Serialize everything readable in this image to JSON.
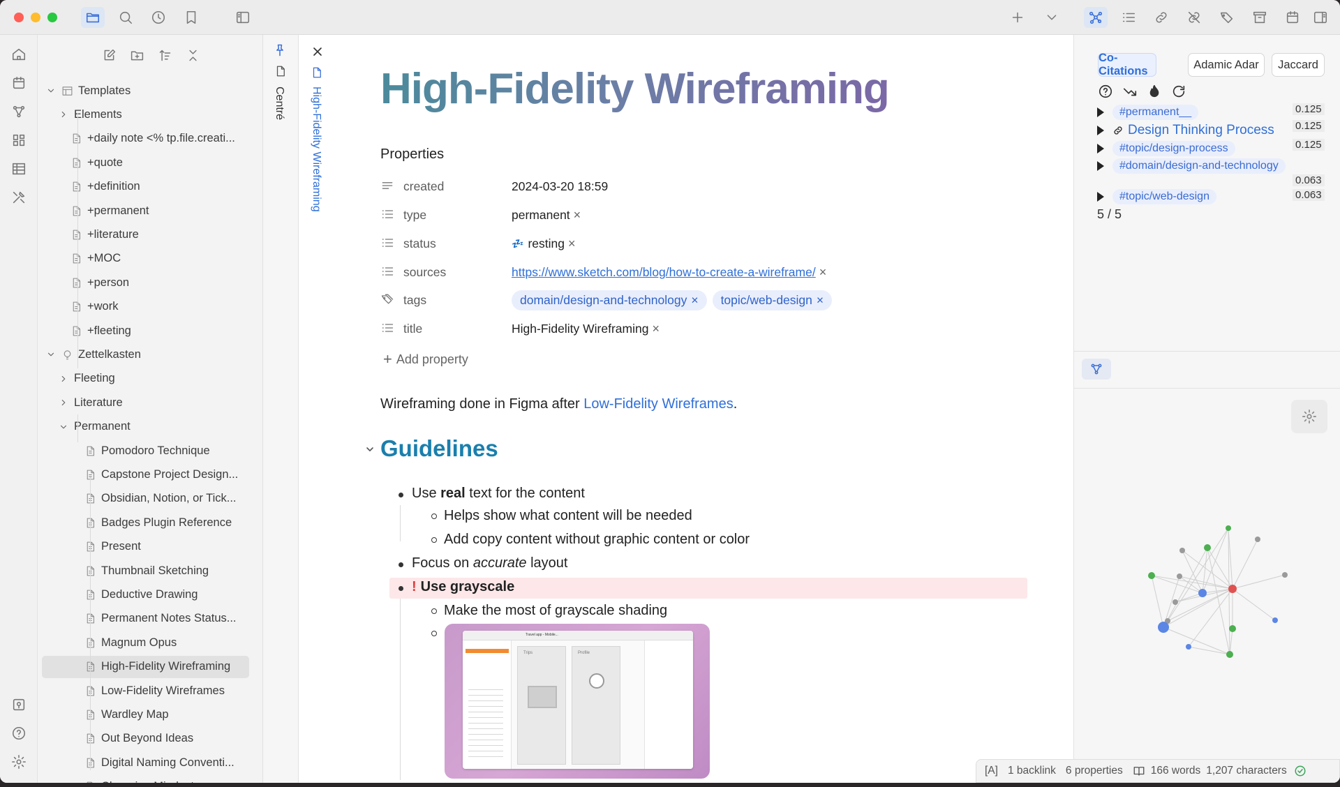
{
  "toolbar": {
    "left_icons": [
      "folder-icon",
      "search-icon",
      "clock-icon",
      "bookmark-icon",
      "sidebar-toggle-icon"
    ],
    "right_icons": [
      "plus-icon",
      "chevron-down-icon",
      "graph-icon",
      "list-icon",
      "links-icon",
      "unlinked-icon",
      "tags-icon",
      "archive-icon",
      "calendar-icon",
      "right-sidebar-icon"
    ]
  },
  "ribbon": {
    "icons": [
      "home-icon",
      "calendar-icon",
      "graph-icon",
      "grid-icon",
      "table-icon",
      "tools-icon",
      "vault-icon",
      "help-icon",
      "settings-icon"
    ]
  },
  "explorer": {
    "tools": [
      "new-note-icon",
      "new-folder-icon",
      "sort-icon",
      "collapse-icon"
    ],
    "items": [
      {
        "label": "Templates",
        "type": "folder-open",
        "level": 0
      },
      {
        "label": "Elements",
        "type": "folder",
        "level": 1
      },
      {
        "label": "+daily note <% tp.file.creati...",
        "type": "file",
        "level": 1
      },
      {
        "label": "+quote",
        "type": "file",
        "level": 1
      },
      {
        "label": "+definition",
        "type": "file",
        "level": 1
      },
      {
        "label": "+permanent",
        "type": "file",
        "level": 1
      },
      {
        "label": "+literature",
        "type": "file",
        "level": 1
      },
      {
        "label": "+MOC",
        "type": "file",
        "level": 1
      },
      {
        "label": "+person",
        "type": "file",
        "level": 1
      },
      {
        "label": "+work",
        "type": "file",
        "level": 1
      },
      {
        "label": "+fleeting",
        "type": "file",
        "level": 1
      },
      {
        "label": "Zettelkasten",
        "type": "folder-open",
        "level": 0
      },
      {
        "label": "Fleeting",
        "type": "folder",
        "level": 1
      },
      {
        "label": "Literature",
        "type": "folder",
        "level": 1
      },
      {
        "label": "Permanent",
        "type": "folder-open",
        "level": 1
      },
      {
        "label": "Pomodoro Technique",
        "type": "file",
        "level": 2
      },
      {
        "label": "Capstone Project Design...",
        "type": "file",
        "level": 2
      },
      {
        "label": "Obsidian, Notion, or Tick...",
        "type": "file",
        "level": 2
      },
      {
        "label": "Badges Plugin Reference",
        "type": "file",
        "level": 2
      },
      {
        "label": "Present",
        "type": "file",
        "level": 2
      },
      {
        "label": "Thumbnail Sketching",
        "type": "file",
        "level": 2
      },
      {
        "label": "Deductive Drawing",
        "type": "file",
        "level": 2
      },
      {
        "label": "Permanent Notes Status...",
        "type": "file",
        "level": 2
      },
      {
        "label": "Magnum Opus",
        "type": "file",
        "level": 2
      },
      {
        "label": "High-Fidelity Wireframing",
        "type": "file",
        "level": 2,
        "selected": true
      },
      {
        "label": "Low-Fidelity Wireframes",
        "type": "file",
        "level": 2
      },
      {
        "label": "Wardley Map",
        "type": "file",
        "level": 2
      },
      {
        "label": "Out Beyond Ideas",
        "type": "file",
        "level": 2
      },
      {
        "label": "Digital Naming Conventi...",
        "type": "file",
        "level": 2
      },
      {
        "label": "Changing Mindset",
        "type": "file",
        "level": 2
      }
    ]
  },
  "sidestrip": {
    "pinned_label": "Centré",
    "tab_label": "High-Fidelity Wireframing"
  },
  "note": {
    "title": "High-Fidelity Wireframing",
    "properties_heading": "Properties",
    "properties": [
      {
        "key": "created",
        "value": "2024-03-20 18:59",
        "icon": "text-icon"
      },
      {
        "key": "type",
        "value": "permanent",
        "icon": "list-icon"
      },
      {
        "key": "status",
        "value": "resting",
        "emoji": "💤",
        "icon": "list-icon"
      },
      {
        "key": "sources",
        "value": "https://www.sketch.com/blog/how-to-create-a-wireframe/",
        "icon": "list-icon"
      },
      {
        "key": "tags",
        "tags": [
          "domain/design-and-technology",
          "topic/web-design"
        ],
        "icon": "tag-icon"
      },
      {
        "key": "title",
        "value": "High-Fidelity Wireframing",
        "icon": "list-icon"
      }
    ],
    "add_property": "Add property",
    "intro_prefix": "Wireframing done in Figma after ",
    "intro_link": "Low-Fidelity Wireframes",
    "intro_suffix": ".",
    "heading": "Guidelines",
    "list": {
      "l1_prefix": "Use ",
      "l1_bold": "real",
      "l1_suffix": " text for the content",
      "l1a": "Helps show what content will be needed",
      "l1b": "Add copy content without graphic content or color",
      "l2_prefix": "Focus on ",
      "l2_italic": "accurate",
      "l2_suffix": " layout",
      "l3_mark": "!",
      "l3": "Use grayscale",
      "l3a": "Make the most of grayscale shading"
    },
    "thumb": {
      "app_title": "Travel app - Mobile...",
      "tab_label": "Trips",
      "profile_label": "Profile"
    }
  },
  "right_panel": {
    "tabs": [
      "Co-Citations",
      "Adamic Adar",
      "Jaccard"
    ],
    "active_tab": "Co-Citations",
    "tool_icons": [
      "help-icon",
      "trend-icon",
      "flame-icon",
      "refresh-icon"
    ],
    "rows": [
      {
        "label": "#permanent__",
        "kind": "tag",
        "score": "0.125"
      },
      {
        "label": "Design Thinking Process",
        "kind": "link",
        "score": "0.125"
      },
      {
        "label": "#topic/design-process",
        "kind": "tag",
        "score": "0.125"
      },
      {
        "label": "#domain/design-and-technology",
        "kind": "tag",
        "score": "0.063"
      },
      {
        "label": "#topic/web-design",
        "kind": "tag",
        "score": "0.063"
      }
    ],
    "count": "5 / 5",
    "graph_tab_icon": "graph-icon",
    "settings_icon": "gear-icon",
    "graph_colors": {
      "green": "#4caf50",
      "blue": "#5b86e5",
      "red": "#e05252",
      "gray": "#9a9a9a"
    }
  },
  "statusbar": {
    "mode": "[A]",
    "backlinks": "1 backlink",
    "properties": "6 properties",
    "words": "166 words",
    "characters": "1,207 characters"
  }
}
